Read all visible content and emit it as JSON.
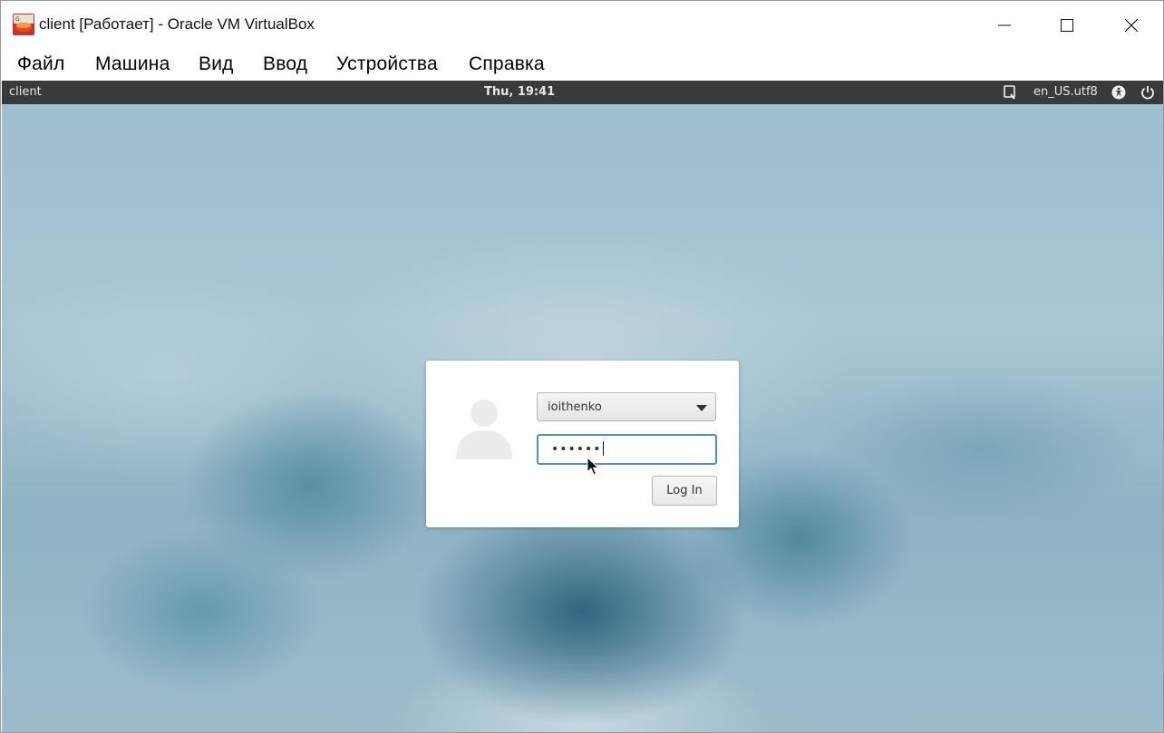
{
  "window": {
    "title": "client [Работает] - Oracle VM VirtualBox",
    "icon": "virtualbox-icon",
    "controls": [
      "minimize-icon",
      "maximize-icon",
      "close-icon"
    ]
  },
  "menubar": {
    "items": [
      "Файл",
      "Машина",
      "Вид",
      "Ввод",
      "Устройства",
      "Справка"
    ]
  },
  "guest_topbar": {
    "hostname": "client",
    "clock": "Thu, 19:41",
    "keyboard_layout": "en_US.utf8",
    "icons": [
      "screen-reader-search-icon",
      "accessibility-icon",
      "power-icon"
    ]
  },
  "login": {
    "username": "ioithenko",
    "password_mask": "••••••",
    "login_button": "Log In",
    "avatar_icon": "user-avatar-icon"
  },
  "colors": {
    "topbar_bg": "#3a3a3a",
    "focus_ring": "#4a90d9",
    "dialog_bg": "#ffffff"
  }
}
